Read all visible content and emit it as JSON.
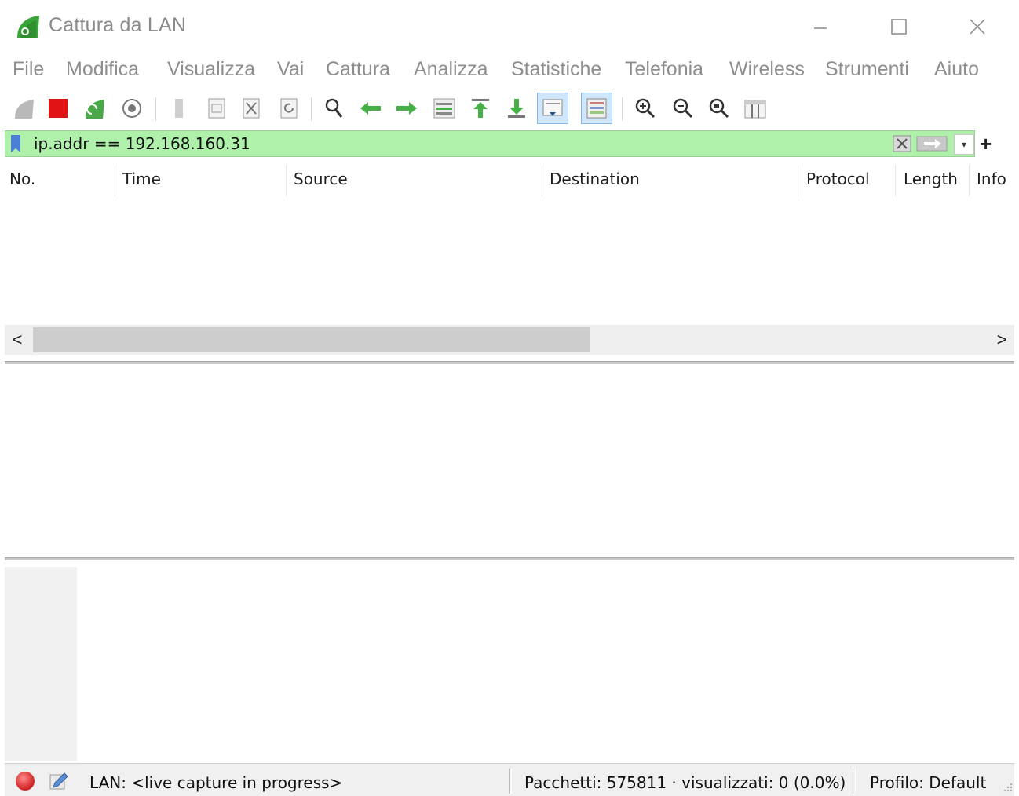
{
  "window": {
    "title": "Cattura da LAN",
    "controls": {
      "minimize": "—",
      "maximize": "☐",
      "close": "✕"
    }
  },
  "menu": [
    "File",
    "Modifica",
    "Visualizza",
    "Vai",
    "Cattura",
    "Analizza",
    "Statistiche",
    "Telefonia",
    "Wireless",
    "Strumenti",
    "Aiuto"
  ],
  "toolbar": {
    "icons": [
      "start-capture-icon",
      "stop-capture-icon",
      "restart-capture-icon",
      "capture-options-icon",
      "open-file-icon",
      "save-file-icon",
      "close-file-icon",
      "reload-file-icon",
      "find-packet-icon",
      "go-back-icon",
      "go-forward-icon",
      "go-to-packet-icon",
      "go-first-packet-icon",
      "go-last-packet-icon",
      "auto-scroll-icon",
      "colorize-icon",
      "zoom-in-icon",
      "zoom-out-icon",
      "normal-size-icon",
      "resize-columns-icon"
    ]
  },
  "filter": {
    "value": "ip.addr == 192.168.160.31",
    "background_color": "#aff0ab",
    "add_label": "+"
  },
  "packet_list": {
    "columns": [
      "No.",
      "Time",
      "Source",
      "Destination",
      "Protocol",
      "Length",
      "Info"
    ],
    "rows": []
  },
  "scrollbar": {
    "left_arrow": "<",
    "right_arrow": ">"
  },
  "status": {
    "capture_label": "LAN: <live capture in progress>",
    "packets_label": "Pacchetti: 575811 · visualizzati: 0 (0.0%)",
    "profile_label": "Profilo: Default"
  }
}
